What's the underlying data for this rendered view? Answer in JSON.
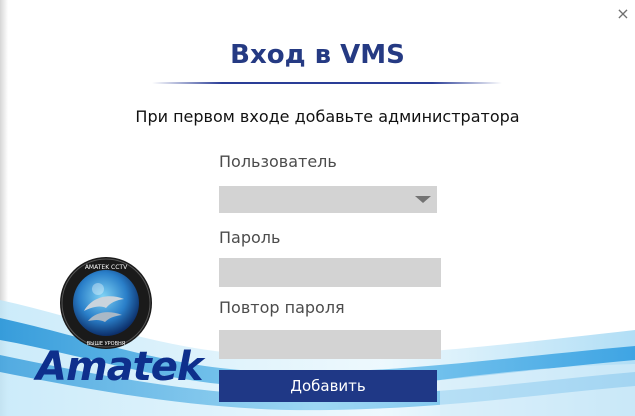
{
  "dialog": {
    "title": "Вход в VMS",
    "subtitle": "При первом входе добавьте администратора",
    "close_label": "×",
    "username_label": "Пользователь",
    "username_value": "",
    "password_label": "Пароль",
    "password_value": "",
    "repeat_password_label": "Повтор пароля",
    "repeat_password_value": "",
    "add_button_label": "Добавить"
  },
  "logo": {
    "brand": "Amatek",
    "badge_text": "AMATEK CCTV",
    "badge_bottom_text": "ВЫШЕ УРОВНЯ"
  },
  "colors": {
    "title": "#253a83",
    "button": "#1f3886",
    "field": "#d3d3d3",
    "logo": "#0e2f8c"
  }
}
